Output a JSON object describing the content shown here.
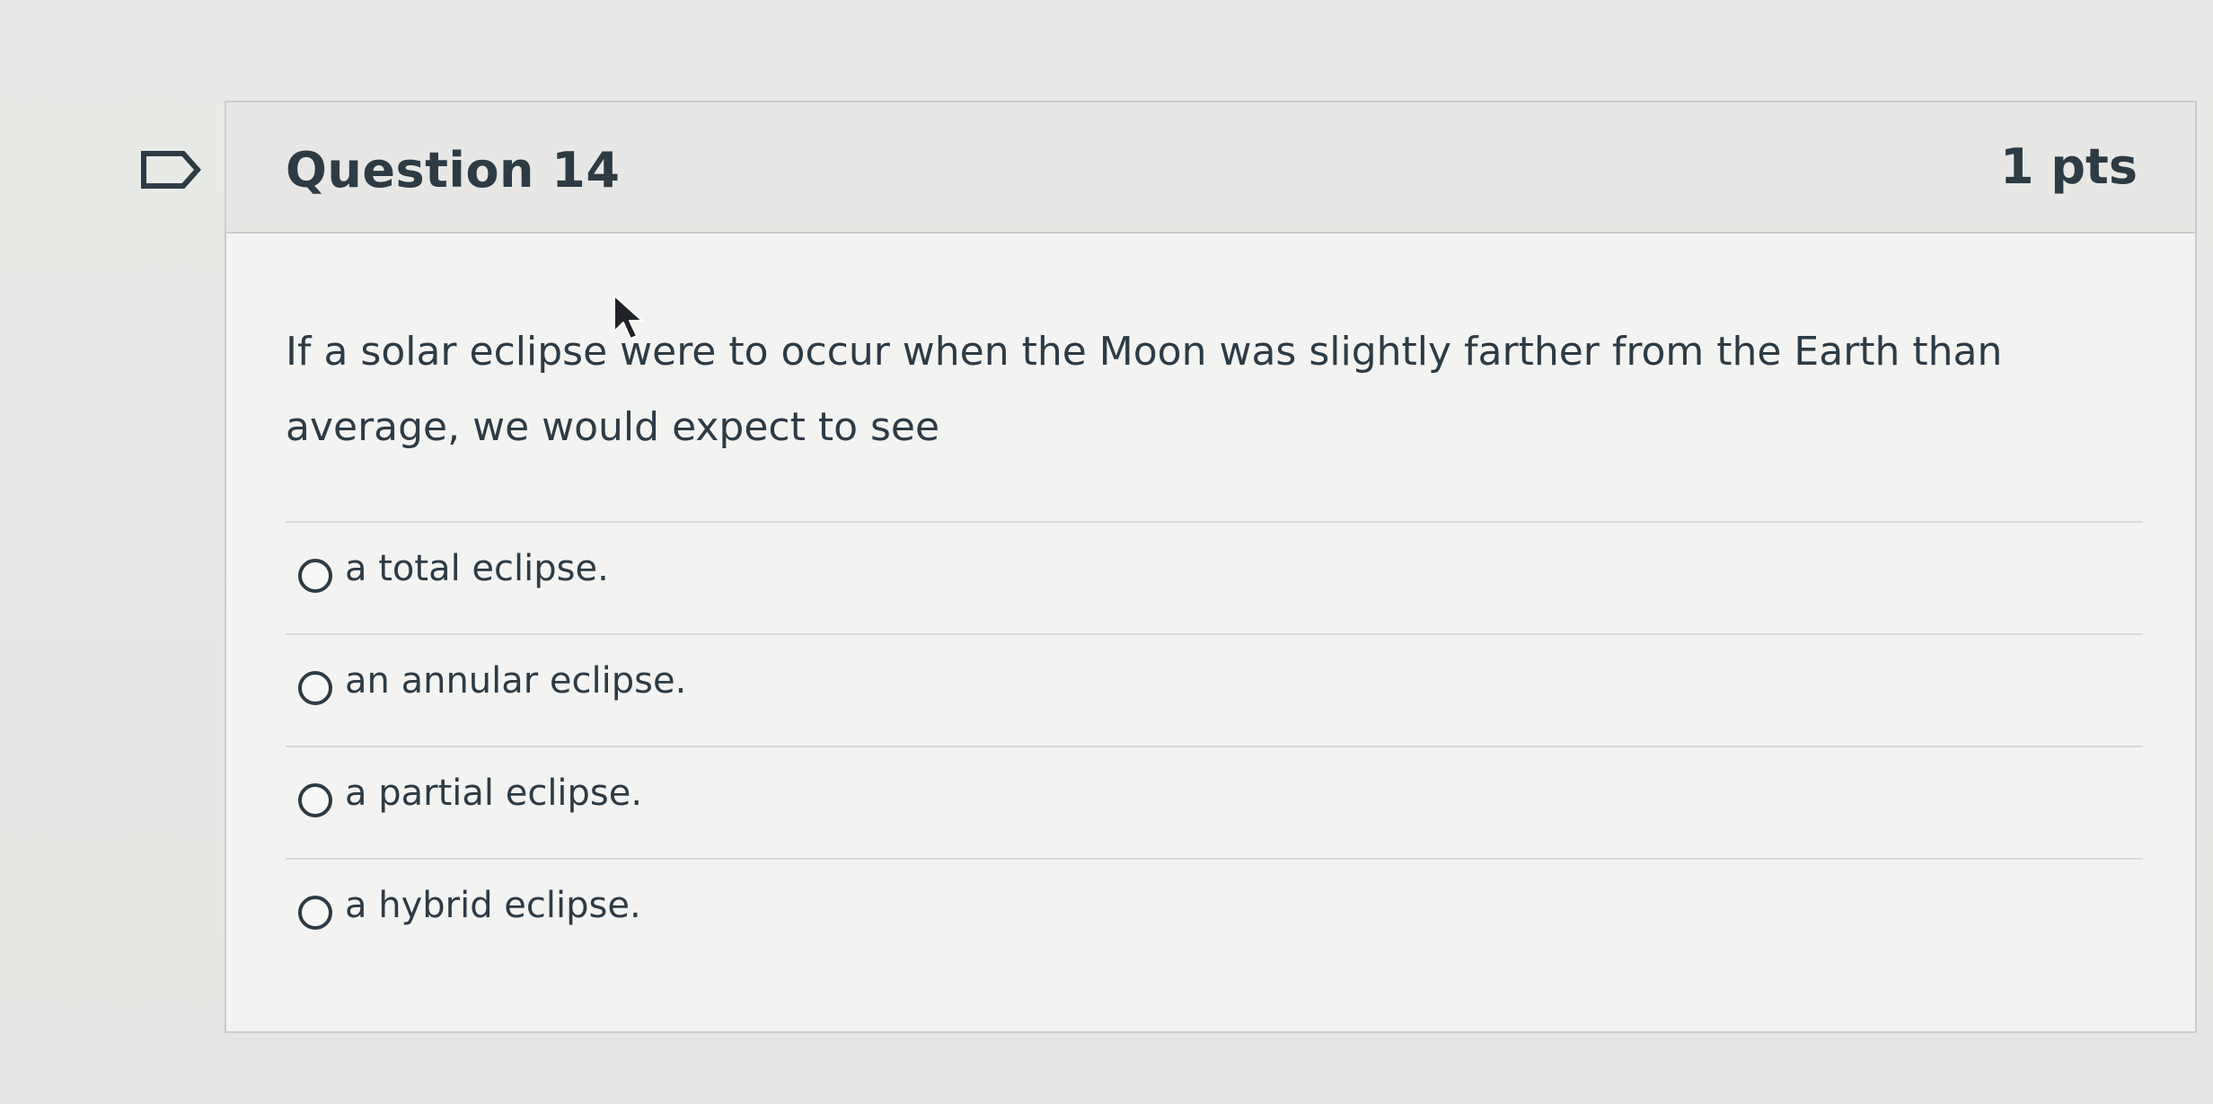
{
  "question": {
    "title": "Question 14",
    "points": "1 pts",
    "text": "If a solar eclipse were to occur when the Moon was slightly farther from the Earth than average, we would expect to see",
    "answers": [
      {
        "label": "a total eclipse."
      },
      {
        "label": "an annular eclipse."
      },
      {
        "label": "a partial eclipse."
      },
      {
        "label": "a hybrid eclipse."
      }
    ]
  },
  "icons": {
    "flag": "flag-icon",
    "radio": "radio-button-icon",
    "cursor": "mouse-pointer-icon"
  },
  "colors": {
    "text": "#2d3b45",
    "border": "#c7cdd1",
    "header_bg": "#e7e8e5",
    "card_bg": "#f3f4f2"
  }
}
